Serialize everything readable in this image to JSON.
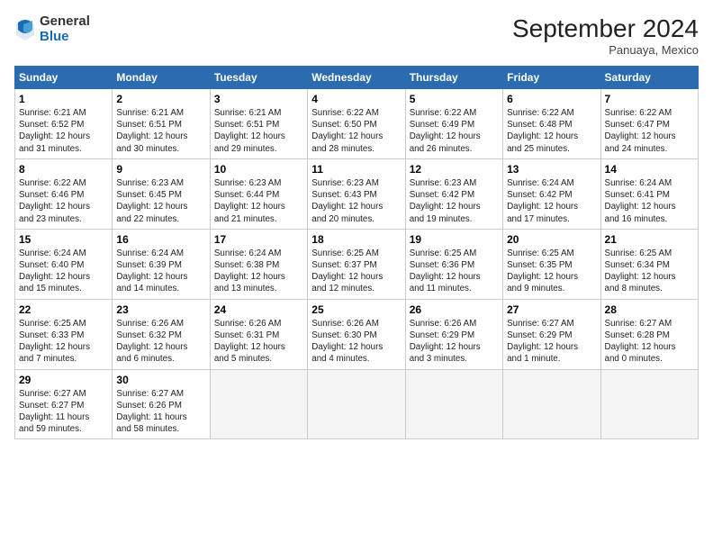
{
  "header": {
    "logo_general": "General",
    "logo_blue": "Blue",
    "month_title": "September 2024",
    "location": "Panuaya, Mexico"
  },
  "columns": [
    "Sunday",
    "Monday",
    "Tuesday",
    "Wednesday",
    "Thursday",
    "Friday",
    "Saturday"
  ],
  "weeks": [
    [
      {
        "day": "1",
        "info": "Sunrise: 6:21 AM\nSunset: 6:52 PM\nDaylight: 12 hours\nand 31 minutes."
      },
      {
        "day": "2",
        "info": "Sunrise: 6:21 AM\nSunset: 6:51 PM\nDaylight: 12 hours\nand 30 minutes."
      },
      {
        "day": "3",
        "info": "Sunrise: 6:21 AM\nSunset: 6:51 PM\nDaylight: 12 hours\nand 29 minutes."
      },
      {
        "day": "4",
        "info": "Sunrise: 6:22 AM\nSunset: 6:50 PM\nDaylight: 12 hours\nand 28 minutes."
      },
      {
        "day": "5",
        "info": "Sunrise: 6:22 AM\nSunset: 6:49 PM\nDaylight: 12 hours\nand 26 minutes."
      },
      {
        "day": "6",
        "info": "Sunrise: 6:22 AM\nSunset: 6:48 PM\nDaylight: 12 hours\nand 25 minutes."
      },
      {
        "day": "7",
        "info": "Sunrise: 6:22 AM\nSunset: 6:47 PM\nDaylight: 12 hours\nand 24 minutes."
      }
    ],
    [
      {
        "day": "8",
        "info": "Sunrise: 6:22 AM\nSunset: 6:46 PM\nDaylight: 12 hours\nand 23 minutes."
      },
      {
        "day": "9",
        "info": "Sunrise: 6:23 AM\nSunset: 6:45 PM\nDaylight: 12 hours\nand 22 minutes."
      },
      {
        "day": "10",
        "info": "Sunrise: 6:23 AM\nSunset: 6:44 PM\nDaylight: 12 hours\nand 21 minutes."
      },
      {
        "day": "11",
        "info": "Sunrise: 6:23 AM\nSunset: 6:43 PM\nDaylight: 12 hours\nand 20 minutes."
      },
      {
        "day": "12",
        "info": "Sunrise: 6:23 AM\nSunset: 6:42 PM\nDaylight: 12 hours\nand 19 minutes."
      },
      {
        "day": "13",
        "info": "Sunrise: 6:24 AM\nSunset: 6:42 PM\nDaylight: 12 hours\nand 17 minutes."
      },
      {
        "day": "14",
        "info": "Sunrise: 6:24 AM\nSunset: 6:41 PM\nDaylight: 12 hours\nand 16 minutes."
      }
    ],
    [
      {
        "day": "15",
        "info": "Sunrise: 6:24 AM\nSunset: 6:40 PM\nDaylight: 12 hours\nand 15 minutes."
      },
      {
        "day": "16",
        "info": "Sunrise: 6:24 AM\nSunset: 6:39 PM\nDaylight: 12 hours\nand 14 minutes."
      },
      {
        "day": "17",
        "info": "Sunrise: 6:24 AM\nSunset: 6:38 PM\nDaylight: 12 hours\nand 13 minutes."
      },
      {
        "day": "18",
        "info": "Sunrise: 6:25 AM\nSunset: 6:37 PM\nDaylight: 12 hours\nand 12 minutes."
      },
      {
        "day": "19",
        "info": "Sunrise: 6:25 AM\nSunset: 6:36 PM\nDaylight: 12 hours\nand 11 minutes."
      },
      {
        "day": "20",
        "info": "Sunrise: 6:25 AM\nSunset: 6:35 PM\nDaylight: 12 hours\nand 9 minutes."
      },
      {
        "day": "21",
        "info": "Sunrise: 6:25 AM\nSunset: 6:34 PM\nDaylight: 12 hours\nand 8 minutes."
      }
    ],
    [
      {
        "day": "22",
        "info": "Sunrise: 6:25 AM\nSunset: 6:33 PM\nDaylight: 12 hours\nand 7 minutes."
      },
      {
        "day": "23",
        "info": "Sunrise: 6:26 AM\nSunset: 6:32 PM\nDaylight: 12 hours\nand 6 minutes."
      },
      {
        "day": "24",
        "info": "Sunrise: 6:26 AM\nSunset: 6:31 PM\nDaylight: 12 hours\nand 5 minutes."
      },
      {
        "day": "25",
        "info": "Sunrise: 6:26 AM\nSunset: 6:30 PM\nDaylight: 12 hours\nand 4 minutes."
      },
      {
        "day": "26",
        "info": "Sunrise: 6:26 AM\nSunset: 6:29 PM\nDaylight: 12 hours\nand 3 minutes."
      },
      {
        "day": "27",
        "info": "Sunrise: 6:27 AM\nSunset: 6:29 PM\nDaylight: 12 hours\nand 1 minute."
      },
      {
        "day": "28",
        "info": "Sunrise: 6:27 AM\nSunset: 6:28 PM\nDaylight: 12 hours\nand 0 minutes."
      }
    ],
    [
      {
        "day": "29",
        "info": "Sunrise: 6:27 AM\nSunset: 6:27 PM\nDaylight: 11 hours\nand 59 minutes."
      },
      {
        "day": "30",
        "info": "Sunrise: 6:27 AM\nSunset: 6:26 PM\nDaylight: 11 hours\nand 58 minutes."
      },
      {
        "day": "",
        "info": ""
      },
      {
        "day": "",
        "info": ""
      },
      {
        "day": "",
        "info": ""
      },
      {
        "day": "",
        "info": ""
      },
      {
        "day": "",
        "info": ""
      }
    ]
  ]
}
